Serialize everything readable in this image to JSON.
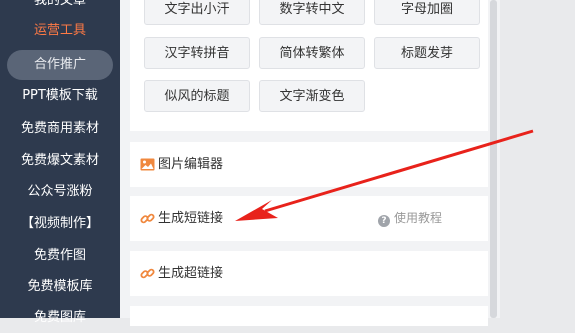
{
  "sidebar": {
    "items": [
      {
        "label": "我的文章"
      },
      {
        "label": "运营工具"
      },
      {
        "label": "合作推广"
      },
      {
        "label": "PPT模板下载"
      },
      {
        "label": "免费商用素材"
      },
      {
        "label": "免费爆文素材"
      },
      {
        "label": "公众号涨粉"
      },
      {
        "label": "【视频制作】"
      },
      {
        "label": "免费作图"
      },
      {
        "label": "免费模板库"
      },
      {
        "label": "免费图库"
      }
    ]
  },
  "tools": {
    "buttons": [
      {
        "label": "文字出小汗"
      },
      {
        "label": "数字转中文"
      },
      {
        "label": "字母加圈"
      },
      {
        "label": "汉字转拼音"
      },
      {
        "label": "简体转繁体"
      },
      {
        "label": "标题发芽"
      },
      {
        "label": "似风的标题"
      },
      {
        "label": "文字渐变色"
      }
    ]
  },
  "rows": {
    "image_editor": {
      "label": "图片编辑器",
      "icon": "image-icon"
    },
    "short_link": {
      "label": "生成短链接",
      "icon": "link-icon",
      "help_label": "使用教程"
    },
    "super_link": {
      "label": "生成超链接",
      "icon": "link-icon"
    }
  },
  "colors": {
    "sidebar_bg": "#2e3a4e",
    "active": "#ff7a45",
    "arrow": "#e8221b",
    "icon_accent": "#f0883e"
  }
}
